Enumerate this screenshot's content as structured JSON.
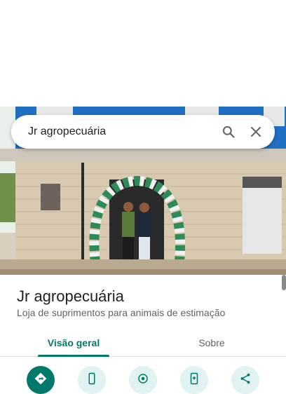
{
  "search": {
    "query": "Jr agropecuária",
    "search_icon": "search-icon",
    "clear_icon": "close-icon"
  },
  "place": {
    "name": "Jr agropecuária",
    "category": "Loja de suprimentos para animais de estimação"
  },
  "tabs": [
    {
      "label": "Visão geral",
      "active": true
    },
    {
      "label": "Sobre",
      "active": false
    }
  ],
  "actions": [
    {
      "icon": "directions-icon"
    },
    {
      "icon": "phone-icon"
    },
    {
      "icon": "location-pin-icon"
    },
    {
      "icon": "add-to-phone-icon"
    },
    {
      "icon": "share-icon"
    }
  ],
  "colors": {
    "accent": "#00796b",
    "accent_light": "#e0f2f1",
    "text_primary": "#202124",
    "text_secondary": "#5f6368"
  }
}
